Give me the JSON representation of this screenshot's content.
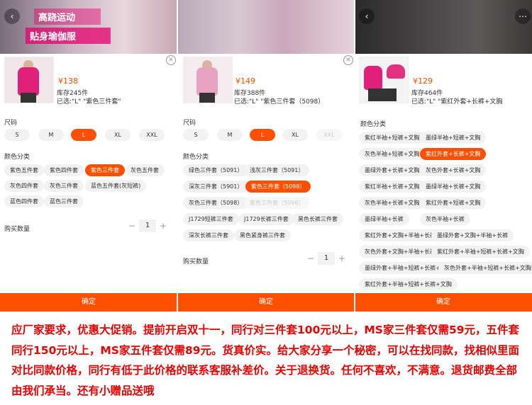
{
  "panels": [
    {
      "price": "¥138",
      "stock": "库存245件",
      "chosen": "已选:\"L\" \"紫色三件套\"",
      "banner_line1": "高跷运动",
      "banner_line2": "贴身瑜伽服",
      "size_title": "尺码",
      "sizes": [
        "S",
        "M",
        "L",
        "XL",
        "XXL"
      ],
      "color_title": "颜色分类",
      "colors": [
        "紫色五件套",
        "紫色四件套",
        "紫色三件套",
        "灰色五件套",
        "灰色四件套",
        "灰色三件套",
        "蓝色五件套(灰短裤)",
        "蓝色四件套",
        "蓝色三件套"
      ],
      "qty_label": "购买数量",
      "qty": "1",
      "confirm": "确定"
    },
    {
      "price": "¥149",
      "stock": "库存388件",
      "chosen": "已选:\"L\" \"紫色三件套（5098）",
      "size_title": "尺码",
      "sizes": [
        "S",
        "M",
        "L",
        "XL",
        "XXL"
      ],
      "color_title": "颜色分类",
      "colors": [
        "绿色三件套（5091）",
        "浅灰三件套（5091）",
        "深灰三件套（5901）",
        "紫色三件套（5098）",
        "灰色三件套（5098）",
        "紫色三件套（5098）",
        "J1729短裤三件套",
        "J1729长裤三件套",
        "黑色长裤三件套",
        "深灰长裤三件套",
        "黑色紧身裤三件套"
      ],
      "qty_label": "购买数量",
      "qty": "1",
      "confirm": "确定"
    },
    {
      "price": "¥129",
      "stock": "库存464件",
      "chosen": "已选:\"L\" \"紫红外套+长裤+文胸",
      "color_title": "颜色分类",
      "colors": [
        "紫红半袖+短裤+文胸",
        "墨绿半袖+短裤+文胸",
        "灰色半袖+短裤+文胸",
        "紫红外套+长裤+文胸",
        "墨绿外套+长裤+文胸",
        "灰色外套+长裤+文胸",
        "紫红半袖+长裤+文胸",
        "墨绿半袖+长裤+文胸",
        "灰色半袖+长裤+文胸",
        "紫红外套+短裤+文胸",
        "墨绿半袖+长裤",
        "灰色半袖+长裤",
        "紫红外套+文胸+半袖+长裤",
        "墨绿外套+文胸+半袖+长裤",
        "灰色外套+文胸+半袖+长裤",
        "紫红外套+半袖+短裤+长裤+文胸",
        "墨绿外套+半袖+短裤+长裤+文胸",
        "灰色外套+半袖+短裤+长裤+文胸",
        "紫红外套+半袖+短裤+长裤+文胸"
      ],
      "confirm": "确定"
    }
  ],
  "caption": "应厂家要求，优惠大促销。提前开启双十一，同行对三件套100元以上，MS家三件套仅需59元，五件套同行150元以上，MS家五件套仅需89元。货真价实。给大家分享一个秘密，可以在找同款，找相似里面对比同款价格，同行有低于此价格的联系客服补差价。关于退换货。任何不喜欢，不满意。退货邮费全部由我们承当。还有小赠品送哦",
  "colors_theme": {
    "accent": "#ff5000",
    "caption": "#e60000"
  },
  "icons": [
    "close-icon",
    "minus-icon",
    "plus-icon"
  ]
}
